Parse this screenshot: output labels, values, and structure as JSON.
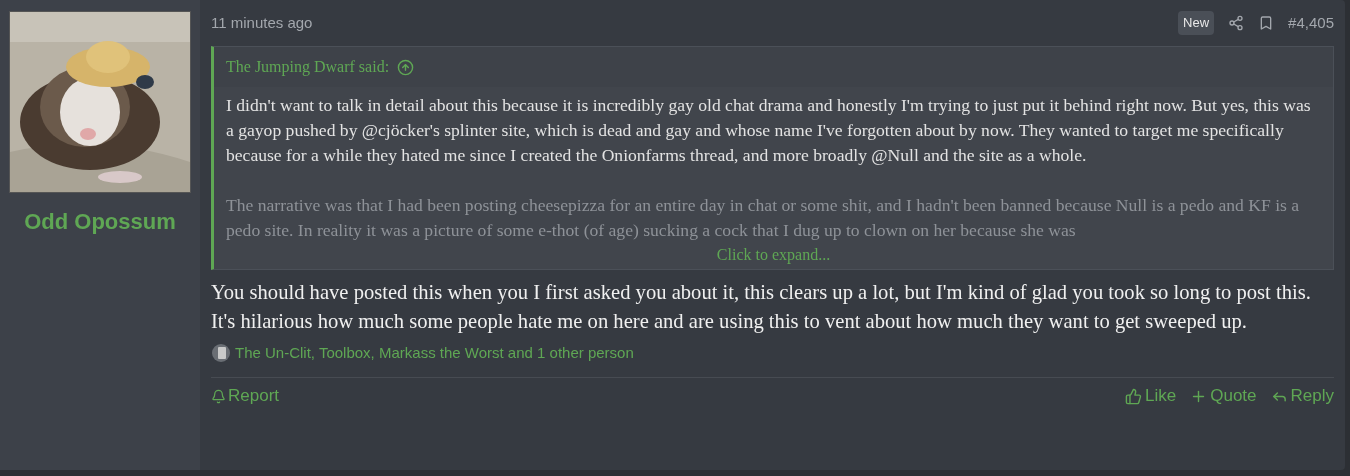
{
  "author": {
    "name": "Odd Opossum"
  },
  "post": {
    "time": "11 minutes ago",
    "badge": "New",
    "number": "#4,405",
    "quote": {
      "attribution": "The Jumping Dwarf said:",
      "paragraphs": [
        "I didn't want to talk in detail about this because it is incredibly gay old chat drama and honestly I'm trying to just put it behind right now. But yes, this was a gayop pushed by @cjöcker's splinter site, which is dead and gay and whose name I've forgotten about by now. They wanted to target me specifically because for a while they hated me since I created the Onionfarms thread, and more broadly @Null and the site as a whole.",
        "The narrative was that I had been posting cheesepizza for an entire day in chat or some shit, and I hadn't been banned because Null is a pedo and KF is a pedo site. In reality it was a picture of some e-thot (of age) sucking a cock that I dug up to clown on her because she was"
      ],
      "expand": "Click to expand..."
    },
    "body": "You should have posted this when you I first asked you about it, this clears up a lot, but I'm kind of glad you took so long to post this. It's hilarious how much some people hate me on here and are using this to vent about how much they want to get sweeped up.",
    "reactions": "The Un-Clit, Toolbox, Markass the Worst and 1 other person",
    "actions_left": [
      "Report"
    ],
    "actions_right": [
      "Like",
      "Quote",
      "Reply"
    ]
  }
}
